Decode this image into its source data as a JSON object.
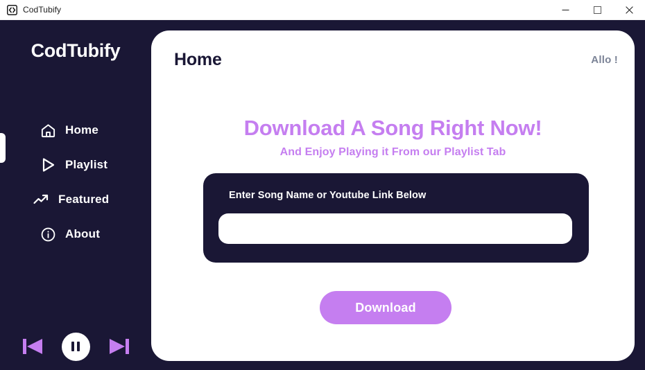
{
  "window": {
    "title": "CodTubify",
    "app_icon": "code-brackets-icon",
    "controls": {
      "minimize": "minimize-icon",
      "maximize": "maximize-icon",
      "close": "close-icon"
    }
  },
  "sidebar": {
    "logo": "CodTubify",
    "background_color": "#1a1735",
    "active_item": "Home",
    "items": [
      {
        "label": "Home",
        "icon": "home-icon",
        "active": true
      },
      {
        "label": "Playlist",
        "icon": "play-triangle-icon",
        "active": false
      },
      {
        "label": "Featured",
        "icon": "trending-up-icon",
        "active": false
      },
      {
        "label": "About",
        "icon": "info-circle-icon",
        "active": false
      }
    ],
    "player": {
      "previous": "skip-previous-icon",
      "play_pause": "pause-icon",
      "next": "skip-next-icon",
      "accent_color": "#c57ef0"
    }
  },
  "main": {
    "page_title": "Home",
    "greeting": "Allo !",
    "hero": {
      "title": "Download A Song Right Now!",
      "subtitle": "And Enjoy Playing it From our Playlist Tab",
      "accent_color": "#c57ef0"
    },
    "search_card": {
      "label": "Enter Song Name or Youtube Link Below",
      "input_value": "",
      "input_placeholder": ""
    },
    "download_button": "Download"
  }
}
